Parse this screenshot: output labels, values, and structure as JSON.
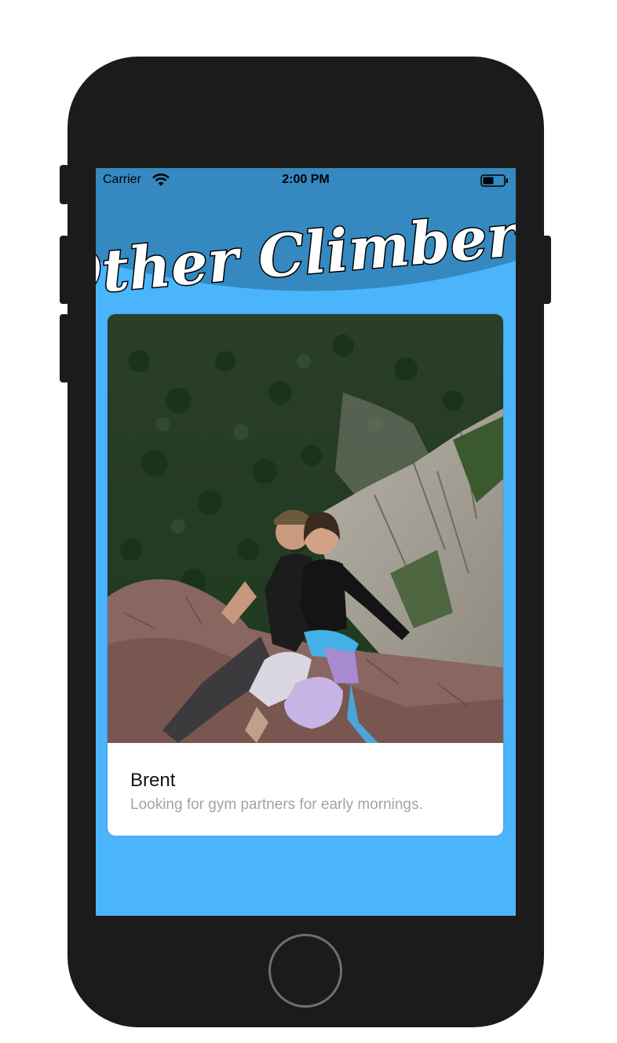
{
  "status_bar": {
    "carrier": "Carrier",
    "time": "2:00 PM"
  },
  "header": {
    "title": "Other Climbers"
  },
  "profile_card": {
    "name": "Brent",
    "bio": "Looking for gym partners for early mornings.",
    "photo_icon": "climbers-photo"
  },
  "colors": {
    "screen_bg": "#4ab5fb",
    "header_bg": "#3589c0",
    "phone_body": "#1b1b1b"
  }
}
